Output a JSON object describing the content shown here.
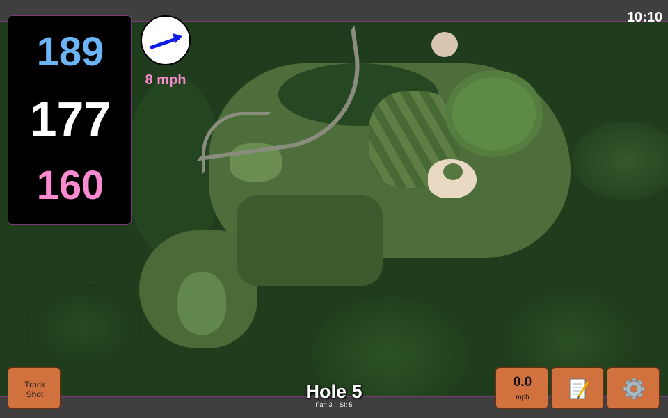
{
  "status": {
    "time": "10:10"
  },
  "distances": {
    "back": "189",
    "center": "177",
    "front": "160",
    "colors": {
      "back": "#6bb4f5",
      "center": "#ffffff",
      "front": "#f98ad0"
    }
  },
  "wind": {
    "speed_label": "8 mph",
    "arrow_color": "#0a1ee6",
    "speed_color": "#f98ad0",
    "icon": "wind-direction-arrow"
  },
  "buttons": {
    "track_shot": {
      "line1": "Track",
      "line2": "Shot"
    },
    "speed": {
      "value": "0.0",
      "unit": "mph"
    },
    "notes": {
      "icon": "notepad-icon"
    },
    "settings": {
      "icon": "gear-icon"
    },
    "accent_color": "#d0713e"
  },
  "hole": {
    "title": "Hole 5",
    "par_label": "Par: 3",
    "si_label": "SI: 5"
  }
}
